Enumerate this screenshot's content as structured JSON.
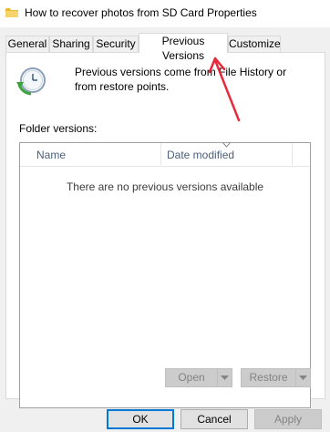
{
  "window": {
    "title": "How to recover photos from SD Card Properties"
  },
  "tabs": [
    {
      "label": "General",
      "active": false
    },
    {
      "label": "Sharing",
      "active": false
    },
    {
      "label": "Security",
      "active": false
    },
    {
      "label": "Previous Versions",
      "active": true
    },
    {
      "label": "Customize",
      "active": false
    }
  ],
  "previous_versions": {
    "intro": "Previous versions come from File History or from restore points.",
    "folder_versions_label": "Folder versions:",
    "columns": [
      "Name",
      "Date modified"
    ],
    "empty_message": "There are no previous versions available",
    "open_button": "Open",
    "restore_button": "Restore"
  },
  "footer": {
    "ok": "OK",
    "cancel": "Cancel",
    "apply": "Apply"
  },
  "colors": {
    "annotation_arrow": "#e8293b",
    "header_text": "#4c607a",
    "default_button_border": "#0078d7"
  },
  "icons": {
    "window": "folder-icon",
    "previous_versions": "clock-restore-icon"
  }
}
